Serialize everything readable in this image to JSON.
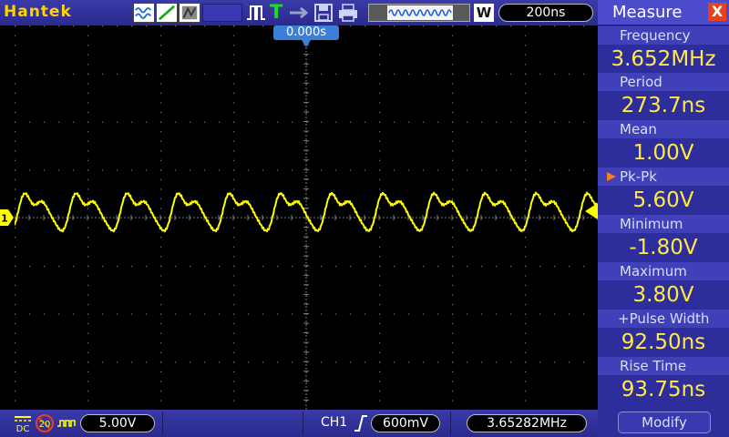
{
  "topbar": {
    "brand": "Hantek",
    "trigger_mode_letter": "T",
    "acq_mode_letter": "W",
    "timebase": "200ns",
    "icons": [
      "wave-mode-icon",
      "vector-icon",
      "persist-icon",
      "pulse-icon",
      "usb-icon",
      "save-icon",
      "print-icon"
    ]
  },
  "scope": {
    "trigger_position": "0.000s",
    "channel_marker": "1",
    "trace_color": "#ffff00",
    "grid_color": "#7a7a7a"
  },
  "bottombar": {
    "coupling": "DC",
    "bw_limit": "20",
    "volts_div": "5.00V",
    "trigger_source": "CH1",
    "trigger_level": "600mV",
    "frequency_counter": "3.65282MHz"
  },
  "measure": {
    "title": "Measure",
    "close_label": "X",
    "items": [
      {
        "label": "Frequency",
        "value": "3.652MHz",
        "selected": false
      },
      {
        "label": "Period",
        "value": "273.7ns",
        "selected": false
      },
      {
        "label": "Mean",
        "value": "1.00V",
        "selected": false
      },
      {
        "label": "Pk-Pk",
        "value": "5.60V",
        "selected": true
      },
      {
        "label": "Minimum",
        "value": "-1.80V",
        "selected": false
      },
      {
        "label": "Maximum",
        "value": "3.80V",
        "selected": false
      },
      {
        "label": "+Pulse Width",
        "value": "92.50ns",
        "selected": false
      },
      {
        "label": "Rise Time",
        "value": "93.75ns",
        "selected": false
      }
    ],
    "modify_label": "Modify"
  },
  "colors": {
    "bar": "#2e2e96",
    "brand": "#ffd200",
    "value": "#ffe94a",
    "trigger_t": "#16e316",
    "close": "#e8401d",
    "select_arrow": "#ff7a1a"
  }
}
